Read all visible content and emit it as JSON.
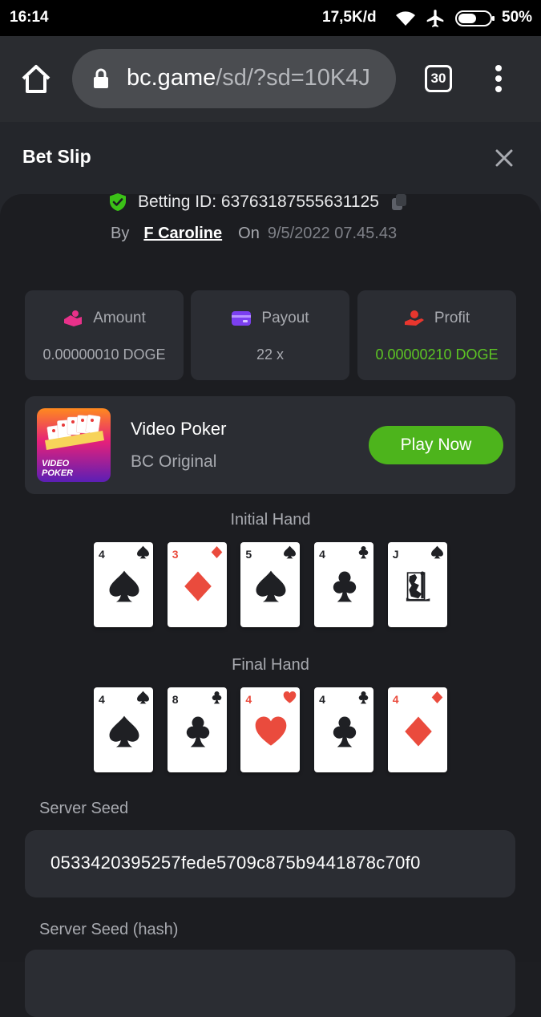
{
  "status_bar": {
    "time": "16:14",
    "network_rate": "17,5K/d",
    "battery": "50%",
    "icons": [
      "wifi-icon",
      "airplane-icon",
      "battery-icon"
    ]
  },
  "browser": {
    "url_host": "bc.game",
    "url_path": "/sd/?sd=10K4J",
    "tab_count": "30"
  },
  "header": {
    "title": "Bet Slip"
  },
  "bet": {
    "betting_id": "Betting ID: 63763187555631125",
    "by_label": "By",
    "user": "F Caroline",
    "on_label": "On",
    "date": "9/5/2022 07.45.43"
  },
  "stats": [
    {
      "label": "Amount",
      "value": "0.00000010 DOGE",
      "icon": "amount-icon",
      "color": "#e8318a"
    },
    {
      "label": "Payout",
      "value": "22 x",
      "icon": "payout-icon",
      "color": "#7b3ff0"
    },
    {
      "label": "Profit",
      "value": "0.00000210 DOGE",
      "icon": "profit-icon",
      "color": "#e8362e",
      "value_color": "#5dc524"
    }
  ],
  "game": {
    "name": "Video Poker",
    "provider": "BC Original",
    "button": "Play Now",
    "thumb_text": "VIDEO POKER"
  },
  "initial_hand": {
    "title": "Initial Hand",
    "cards": [
      {
        "rank": "4",
        "suit": "spade"
      },
      {
        "rank": "3",
        "suit": "diamond"
      },
      {
        "rank": "5",
        "suit": "spade"
      },
      {
        "rank": "4",
        "suit": "club"
      },
      {
        "rank": "J",
        "suit": "spade"
      }
    ]
  },
  "final_hand": {
    "title": "Final Hand",
    "cards": [
      {
        "rank": "4",
        "suit": "spade"
      },
      {
        "rank": "8",
        "suit": "club"
      },
      {
        "rank": "4",
        "suit": "heart"
      },
      {
        "rank": "4",
        "suit": "club"
      },
      {
        "rank": "4",
        "suit": "diamond"
      }
    ]
  },
  "server_seed": {
    "label": "Server Seed",
    "value": "0533420395257fede5709c875b9441878c70f0"
  },
  "server_seed_hash": {
    "label": "Server Seed (hash)"
  },
  "colors": {
    "accent_green": "#4db41c",
    "profit_green": "#5dc524",
    "background": "#1c1d21",
    "card_bg": "#2b2d33"
  }
}
